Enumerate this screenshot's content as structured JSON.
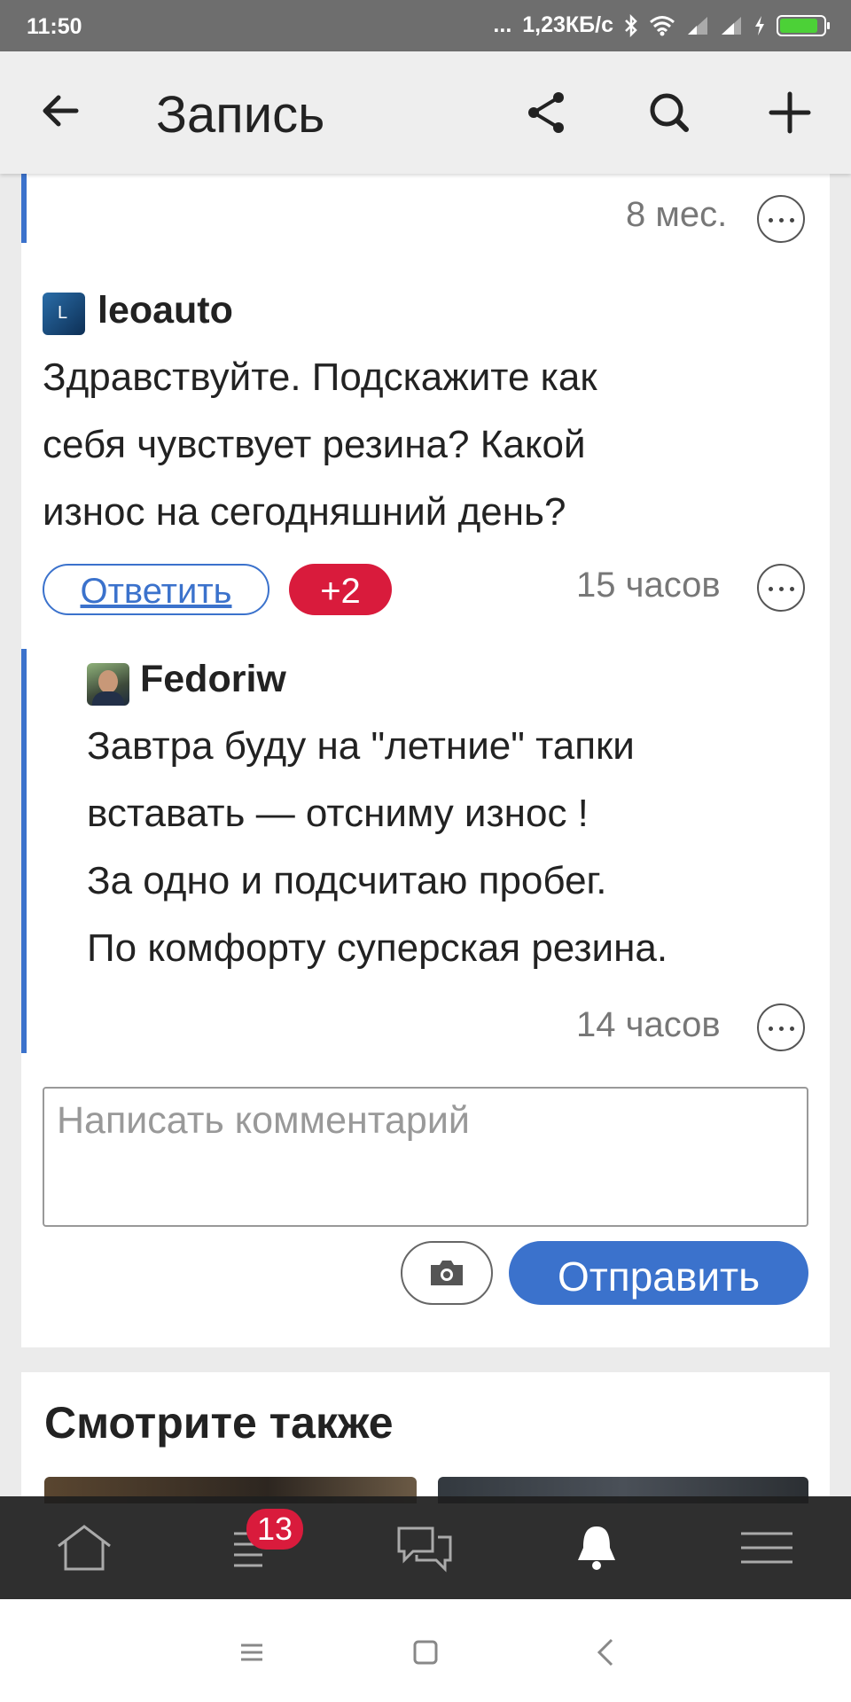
{
  "status_bar": {
    "time": "11:50",
    "speed": "1,23КБ/с",
    "dots": "..."
  },
  "app_bar": {
    "title": "Запись",
    "icons": [
      "back-arrow-icon",
      "share-icon",
      "search-icon",
      "plus-icon"
    ]
  },
  "prev_comment": {
    "time": "8 мес."
  },
  "comment": {
    "author": "leoauto",
    "avatar_letter": "L",
    "lines": [
      "Здравствуйте. Подскажите как",
      "себя чувствует резина? Какой",
      "износ на сегодняшний день?"
    ],
    "reply_label": "Ответить",
    "votes": "+2",
    "time": "15 часов"
  },
  "reply": {
    "author": "Fedoriw",
    "lines": [
      "Завтра буду на \"летние\" тапки",
      "вставать — отсниму износ !",
      "За одно и подсчитаю пробег.",
      "По комфорту суперская резина."
    ],
    "time": "14 часов"
  },
  "comment_form": {
    "placeholder": "Написать комментарий",
    "send_label": "Отправить"
  },
  "see_also": {
    "heading": "Смотрите также"
  },
  "bottom_nav": {
    "badge": "13",
    "items": [
      "home-icon",
      "feed-icon",
      "messages-icon",
      "bell-icon",
      "menu-icon"
    ]
  },
  "colors": {
    "accent": "#3b72cc",
    "badge": "#d91b3c"
  }
}
